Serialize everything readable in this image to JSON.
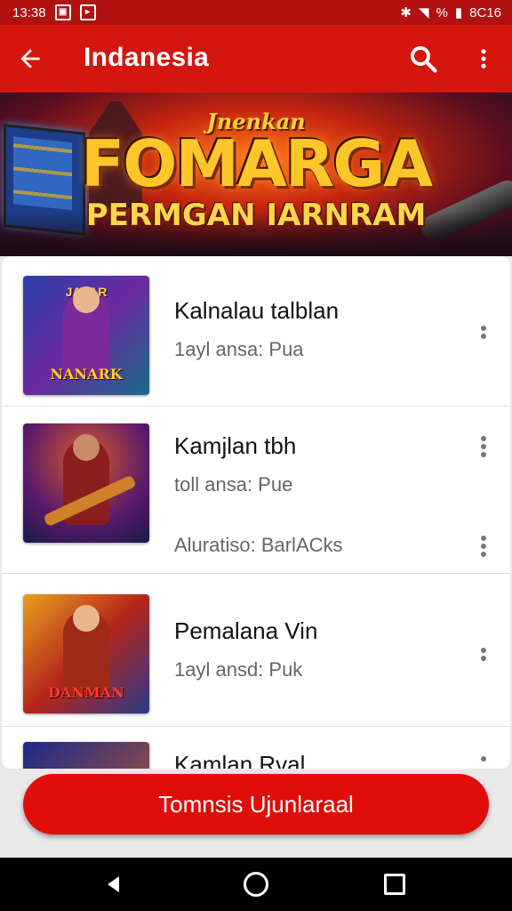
{
  "status": {
    "time": "13:38",
    "left_icons": [
      "gallery-icon",
      "notification-icon"
    ],
    "right_text": "8C16",
    "percent": "%"
  },
  "appbar": {
    "title": "Indanesia",
    "back_icon": "arrow-left-icon",
    "search_icon": "search-icon",
    "more_icon": "more-vert-icon"
  },
  "banner": {
    "subtitle": "Jnenkan",
    "title": "FOMARGA",
    "tagline": "PERMGAN IARNRAM"
  },
  "list": {
    "items": [
      {
        "title": "Kalnalau talblan",
        "subtitle": "1ayl ansa: Pua",
        "thumb_top": "JALAR",
        "thumb_label": "NANARK"
      },
      {
        "title": "Kamjlan tbh",
        "subtitle": "toll ansa: Pue",
        "extra": "Aluratiso: BarlACks",
        "thumb_top": "",
        "thumb_label": ""
      },
      {
        "title": "Pemalanа Vin",
        "subtitle": "1ayl ansd: Puk",
        "thumb_top": "",
        "thumb_label": "DANMAN"
      },
      {
        "title": "Kamlan Rval",
        "subtitle": "",
        "thumb_top": "",
        "thumb_label": ""
      }
    ]
  },
  "fab": {
    "label": "Tomnsis Ujunlaraal"
  },
  "navbar": {
    "back_icon": "nav-back-icon",
    "home_icon": "nav-home-icon",
    "recent_icon": "nav-recents-icon"
  }
}
